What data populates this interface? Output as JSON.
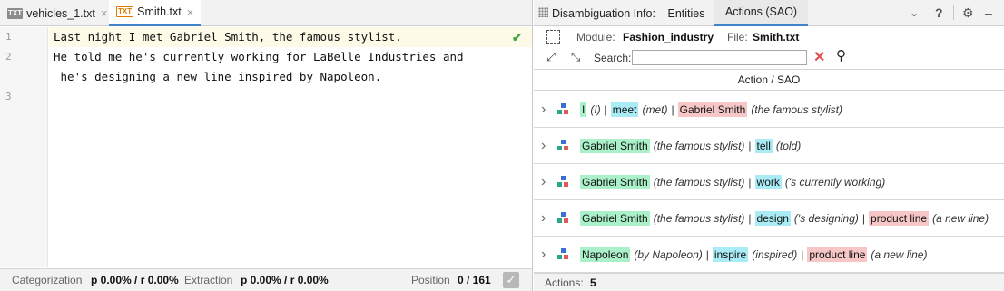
{
  "tabs": [
    {
      "icon": "TXT",
      "label": "vehicles_1.txt",
      "close": "×"
    },
    {
      "icon": "TXT",
      "label": "Smith.txt",
      "close": "×"
    }
  ],
  "editor": {
    "line_numbers": [
      "1",
      "2",
      "3"
    ],
    "lines": [
      "Last night I met Gabriel Smith, the famous stylist.",
      "He told me he's currently working for LaBelle Industries and",
      " he's designing a new line inspired by Napoleon."
    ]
  },
  "status_left": {
    "categorization_label": "Categorization",
    "categorization_value": "p 0.00% / r 0.00%",
    "extraction_label": "Extraction",
    "extraction_value": "p 0.00% / r 0.00%",
    "position_label": "Position",
    "position_value": "0 / 161"
  },
  "panel": {
    "title": "Disambiguation Info:",
    "tabs": [
      "Entities",
      "Actions (SAO)"
    ],
    "active_tab": "Actions (SAO)",
    "module_label": "Module:",
    "module_value": "Fashion_industry",
    "file_label": "File:",
    "file_value": "Smith.txt",
    "search_label": "Search:",
    "search_value": "",
    "column_header": "Action / SAO",
    "rows": [
      {
        "parts": [
          {
            "text": "I",
            "color": "g",
            "note": "(I)"
          },
          {
            "text": "meet",
            "color": "b",
            "note": "(met)"
          },
          {
            "text": "Gabriel Smith",
            "color": "r",
            "note": "(the famous stylist)"
          }
        ]
      },
      {
        "parts": [
          {
            "text": "Gabriel Smith",
            "color": "g",
            "note": "(the famous stylist)"
          },
          {
            "text": "tell",
            "color": "b",
            "note": "(told)"
          }
        ]
      },
      {
        "parts": [
          {
            "text": "Gabriel Smith",
            "color": "g",
            "note": "(the famous stylist)"
          },
          {
            "text": "work",
            "color": "b",
            "note": "('s currently working)"
          }
        ]
      },
      {
        "parts": [
          {
            "text": "Gabriel Smith",
            "color": "g",
            "note": "(the famous stylist)"
          },
          {
            "text": "design",
            "color": "b",
            "note": "('s designing)"
          },
          {
            "text": "product line",
            "color": "r",
            "note": "(a new line)"
          }
        ]
      },
      {
        "parts": [
          {
            "text": "Napoleon",
            "color": "g",
            "note": "(by Napoleon)"
          },
          {
            "text": "inspire",
            "color": "b",
            "note": "(inspired)"
          },
          {
            "text": "product line",
            "color": "r",
            "note": "(a new line)"
          }
        ]
      }
    ],
    "actions_label": "Actions:",
    "actions_count": "5"
  },
  "colors": {
    "subject": "#aaf0c8",
    "action": "#a9ecf6",
    "object": "#f7c7c7",
    "accent": "#4083c9"
  }
}
